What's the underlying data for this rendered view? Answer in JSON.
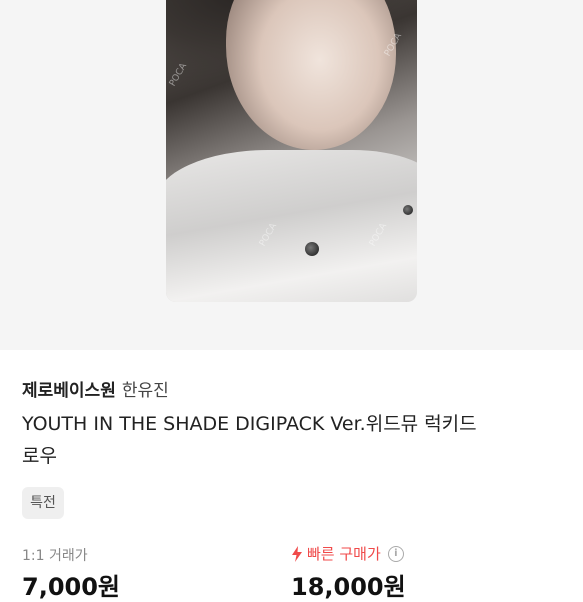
{
  "product": {
    "store_name": "제로베이스원",
    "member_name": "한유진",
    "title": "YOUTH IN THE SHADE DIGIPACK Ver.위드뮤 럭키드로우",
    "tag": "특전",
    "watermark": "POCA"
  },
  "pricing": {
    "left_label": "1:1 거래가",
    "left_price": "7,000원",
    "right_label": "빠른 구매가",
    "right_price": "18,000원",
    "accent_color": "#f04a4a",
    "info_icon": "info-icon",
    "bolt_icon": "lightning-bolt-icon"
  }
}
